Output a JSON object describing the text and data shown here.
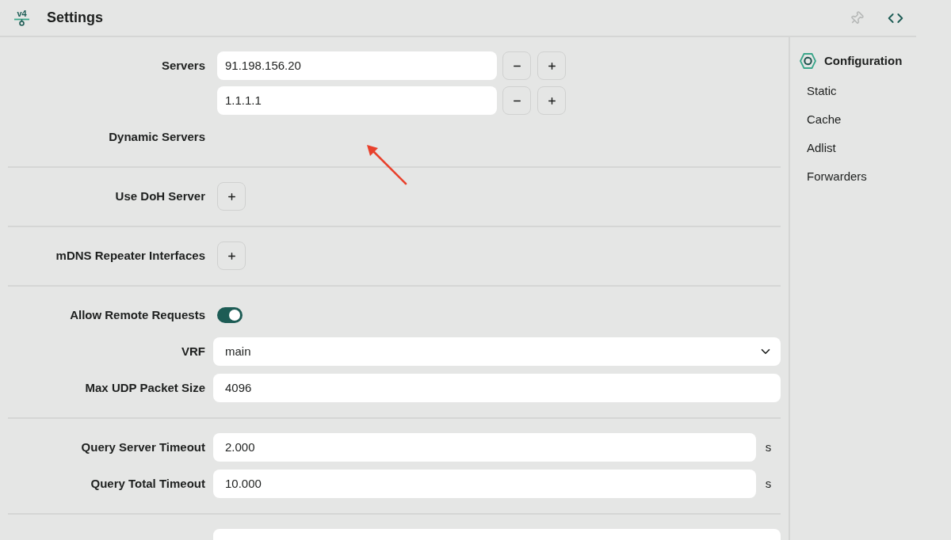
{
  "header": {
    "logo_text": "v4",
    "title": "Settings",
    "toolbar": [
      {
        "kind": "pin",
        "disabled": true
      },
      {
        "kind": "code",
        "disabled": false
      }
    ]
  },
  "form": {
    "sections": [
      {
        "rows": [
          {
            "kind": "list",
            "label": "Servers",
            "values": [
              "91.198.156.20",
              "1.1.1.1"
            ]
          },
          {
            "kind": "label",
            "label": "Dynamic Servers"
          }
        ]
      },
      {
        "rows": [
          {
            "kind": "add",
            "label": "Use DoH Server"
          }
        ]
      },
      {
        "rows": [
          {
            "kind": "add",
            "label": "mDNS Repeater Interfaces"
          }
        ]
      },
      {
        "rows": [
          {
            "kind": "toggle",
            "label": "Allow Remote Requests",
            "on": true
          },
          {
            "kind": "select",
            "label": "VRF",
            "value": "main"
          },
          {
            "kind": "input",
            "label": "Max UDP Packet Size",
            "value": "4096"
          }
        ]
      },
      {
        "rows": [
          {
            "kind": "input",
            "label": "Query Server Timeout",
            "value": "2.000",
            "unit": "s"
          },
          {
            "kind": "input",
            "label": "Query Total Timeout",
            "value": "10.000",
            "unit": "s"
          }
        ]
      },
      {
        "rows": [
          {
            "kind": "input"
          }
        ]
      }
    ]
  },
  "sidebar": {
    "heading": "Configuration",
    "items": [
      "Static",
      "Cache",
      "Adlist",
      "Forwarders"
    ]
  },
  "annotations": [
    {
      "kind": "arrow"
    }
  ]
}
